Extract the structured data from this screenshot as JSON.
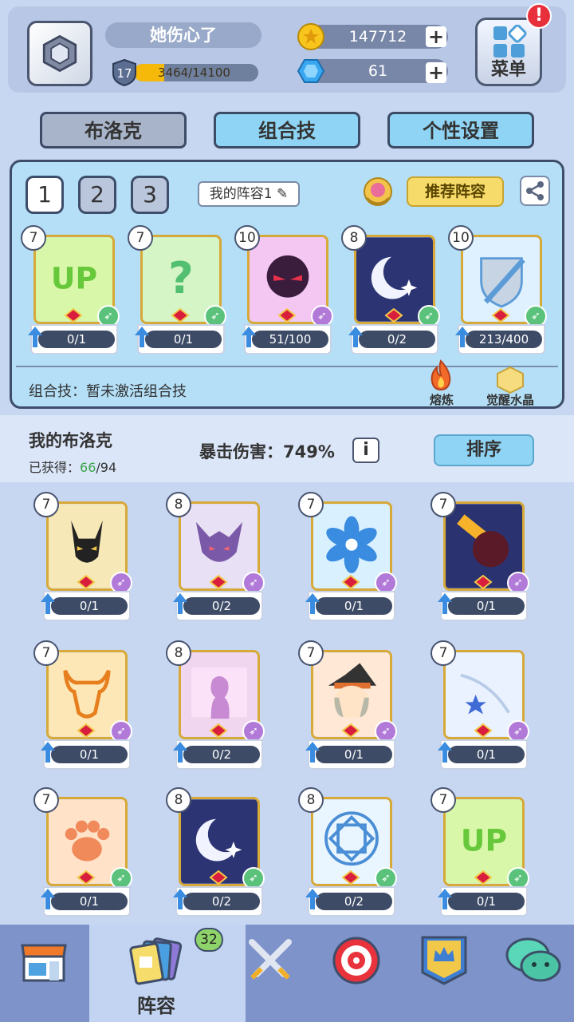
{
  "player": {
    "name": "她伤心了",
    "level": "17",
    "xp_text": "3464/14100",
    "xp_fraction": 0.2457
  },
  "currency": {
    "gold": "147712",
    "gems": "61"
  },
  "menu": {
    "label": "菜单",
    "alert": "!"
  },
  "tabs": [
    {
      "label": "布洛克"
    },
    {
      "label": "组合技"
    },
    {
      "label": "个性设置"
    }
  ],
  "lineup": {
    "slots": [
      "1",
      "2",
      "3"
    ],
    "name": "我的阵容1",
    "recommend_label": "推荐阵容",
    "combo_text": "组合技：暂未激活组合技",
    "smelt_label": "熔炼",
    "crystal_label": "觉醒水晶",
    "cards": [
      {
        "level": "7",
        "progress": "0/1",
        "icon": "up-icon"
      },
      {
        "level": "7",
        "progress": "0/1",
        "icon": "question-icon"
      },
      {
        "level": "10",
        "progress": "51/100",
        "icon": "ninja-icon"
      },
      {
        "level": "8",
        "progress": "0/2",
        "icon": "moon-icon"
      },
      {
        "level": "10",
        "progress": "213/400",
        "icon": "sword-shield-icon"
      }
    ]
  },
  "collection": {
    "title": "我的布洛克",
    "owned_label": "已获得：",
    "owned_value": "66",
    "owned_total": "/94",
    "crit_text": "暴击伤害：749%",
    "info_label": "i",
    "sort_label": "排序",
    "cards": [
      {
        "level": "7",
        "progress": "0/1",
        "icon": "anubis-icon"
      },
      {
        "level": "8",
        "progress": "0/2",
        "icon": "demon-icon"
      },
      {
        "level": "7",
        "progress": "0/1",
        "icon": "snowflower-icon"
      },
      {
        "level": "7",
        "progress": "0/1",
        "icon": "meteor-icon"
      },
      {
        "level": "7",
        "progress": "0/1",
        "icon": "bull-icon"
      },
      {
        "level": "8",
        "progress": "0/2",
        "icon": "silhouette-flag-icon"
      },
      {
        "level": "7",
        "progress": "0/1",
        "icon": "witch-icon"
      },
      {
        "level": "7",
        "progress": "0/1",
        "icon": "star-wind-icon"
      },
      {
        "level": "7",
        "progress": "0/1",
        "icon": "paw-icon"
      },
      {
        "level": "8",
        "progress": "0/2",
        "icon": "moon-icon"
      },
      {
        "level": "8",
        "progress": "0/2",
        "icon": "rune-icon"
      },
      {
        "level": "7",
        "progress": "0/1",
        "icon": "up-icon"
      }
    ]
  },
  "nav": {
    "selected_label": "阵容",
    "badge": "32",
    "items": [
      "shop-icon",
      "cards-icon",
      "battle-icon",
      "target-icon",
      "guild-icon",
      "chat-icon"
    ]
  }
}
